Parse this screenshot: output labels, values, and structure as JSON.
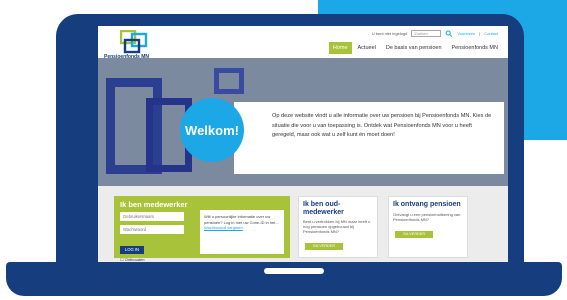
{
  "colors": {
    "navy": "#163d7e",
    "brand_blue": "#1ca7e6",
    "brand_green": "#a8c23a"
  },
  "header": {
    "logo_text": "Pensioenfonds MN",
    "util_login": "U bent niet ingelogd",
    "search_placeholder": "Zoeken",
    "util_link1": "Voorlezen",
    "util_link2": "Contact"
  },
  "nav": {
    "items": [
      "Home",
      "Actueel",
      "De basis van pensioen",
      "Pensioenfonds MN"
    ],
    "active": 0
  },
  "hero": {
    "welcome": "Welkom!",
    "intro": "Op deze website vindt u alle informatie over uw pensioen bij Pensioenfonds MN. Kies de situatie die voor u van toepassing is. Ontdek wat Pensioenfonds MN voor u heeft geregeld, maar ook wat u zelf kunt én moet doen!"
  },
  "cards": {
    "employee": {
      "title": "Ik ben medewerker",
      "username_placeholder": "Gebruikersnaam",
      "password_placeholder": "Wachtwoord",
      "login_label": "LOG IN",
      "remember_label": "Onthouden",
      "info": "Wilt u persoonlijke informatie over uw pensioen? Log in met uw Cone-ID in het...",
      "link": "Wachtwoord vergeten"
    },
    "former": {
      "title": "Ik ben oud-medewerker",
      "text": "Bent u vertrokken bij MN maar heeft u nog pensioen opgebouwd bij Pensioenfonds MN?",
      "button": "GA VERDER"
    },
    "retired": {
      "title": "Ik ontvang pensioen",
      "text": "Ontvangt u een pensioenuitkering van Pensioenfonds MN?",
      "button": "GA VERDER"
    }
  }
}
